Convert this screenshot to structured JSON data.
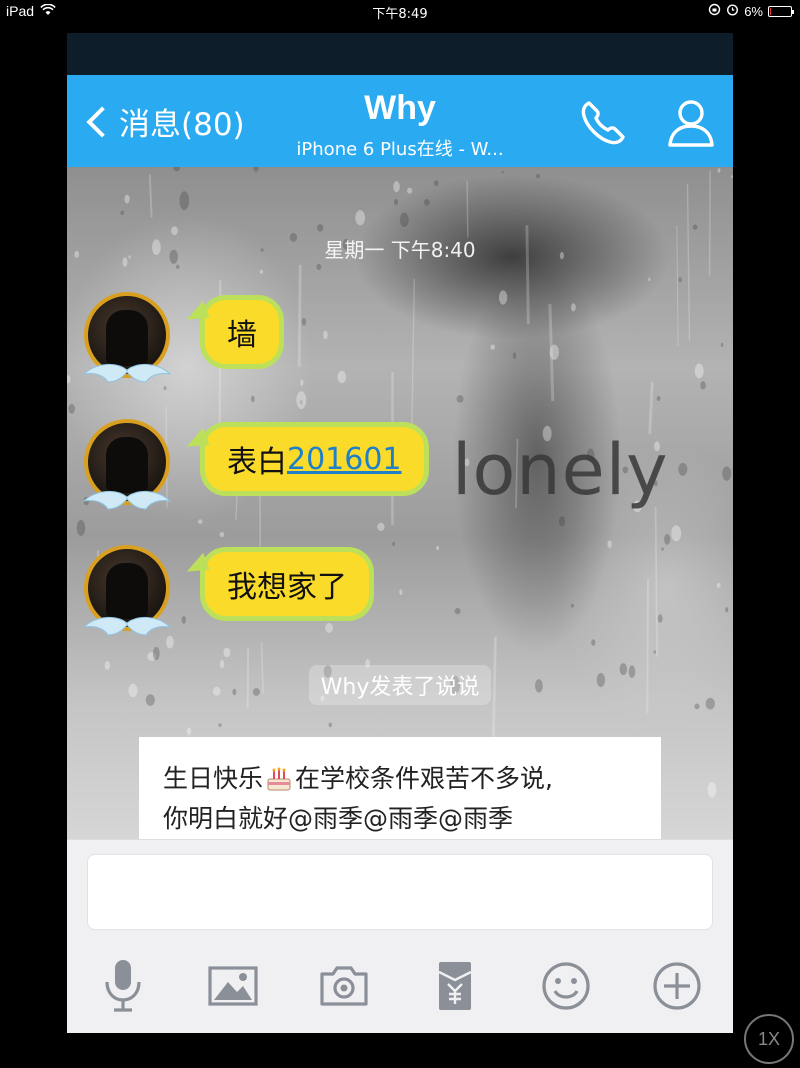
{
  "status_bar": {
    "device": "iPad",
    "time": "下午8:49",
    "battery_text": "6%",
    "battery_level": 0.06
  },
  "nav": {
    "back_label": "消息(80)",
    "title": "Why",
    "subtitle": "iPhone 6 Plus在线 - W..."
  },
  "chat": {
    "timestamp": "星期一 下午8:40",
    "background_text": "lonely",
    "messages": [
      {
        "text": "墙"
      },
      {
        "text": "表白",
        "link": "201601"
      },
      {
        "text": "我想家了"
      }
    ],
    "post_notice": "Why发表了说说",
    "post": {
      "line1_before": "生日快乐",
      "line1_after": "在学校条件艰苦不多说,",
      "line2": "你明白就好@雨季@雨季@雨季"
    }
  },
  "composer": {
    "placeholder": "",
    "tools": [
      "microphone-icon",
      "image-icon",
      "camera-icon",
      "red-packet-icon",
      "emoji-icon",
      "plus-icon"
    ]
  },
  "zoom_label": "1X",
  "colors": {
    "nav_bar": "#2aaaf0",
    "bubble_fill": "#fbdb2a",
    "bubble_border": "#bde05a",
    "link": "#1f7fc9",
    "avatar_ring": "#d9a020"
  }
}
